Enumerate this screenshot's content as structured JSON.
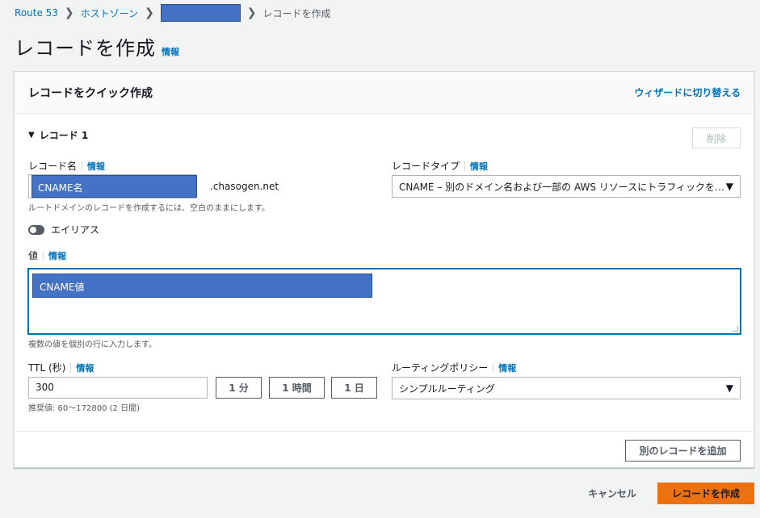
{
  "breadcrumb": {
    "items": [
      "Route 53",
      "ホストゾーン"
    ],
    "current": "レコードを作成"
  },
  "page": {
    "title": "レコードを作成",
    "info": "情報"
  },
  "panel": {
    "title": "レコードをクイック作成",
    "wizard_link": "ウィザードに切り替える",
    "record_label": "レコード 1",
    "delete_label": "削除",
    "record_name": {
      "label": "レコード名",
      "info": "情報",
      "value": "CNAME名",
      "suffix": ".chasogen.net",
      "hint": "ルートドメインのレコードを作成するには、空白のままにします。"
    },
    "record_type": {
      "label": "レコードタイプ",
      "info": "情報",
      "value": "CNAME – 別のドメイン名および一部の AWS リソースにトラフィックを…"
    },
    "alias": {
      "label": "エイリアス",
      "enabled": false
    },
    "value": {
      "label": "値",
      "info": "情報",
      "content": "CNAME値",
      "hint": "複数の値を個別の行に入力します。"
    },
    "ttl": {
      "label": "TTL (秒)",
      "info": "情報",
      "value": "300",
      "buttons": [
        "1 分",
        "1 時間",
        "1 日"
      ],
      "hint": "推奨値: 60〜172800 (2 日間)"
    },
    "routing_policy": {
      "label": "ルーティングポリシー",
      "info": "情報",
      "value": "シンプルルーティング"
    },
    "add_record_label": "別のレコードを追加"
  },
  "footer": {
    "cancel_label": "キャンセル",
    "create_label": "レコードを作成"
  },
  "colors": {
    "link": "#0073bb",
    "primary_button": "#ec7211",
    "redaction": "#4472c4",
    "focus_border": "#0073bb"
  }
}
